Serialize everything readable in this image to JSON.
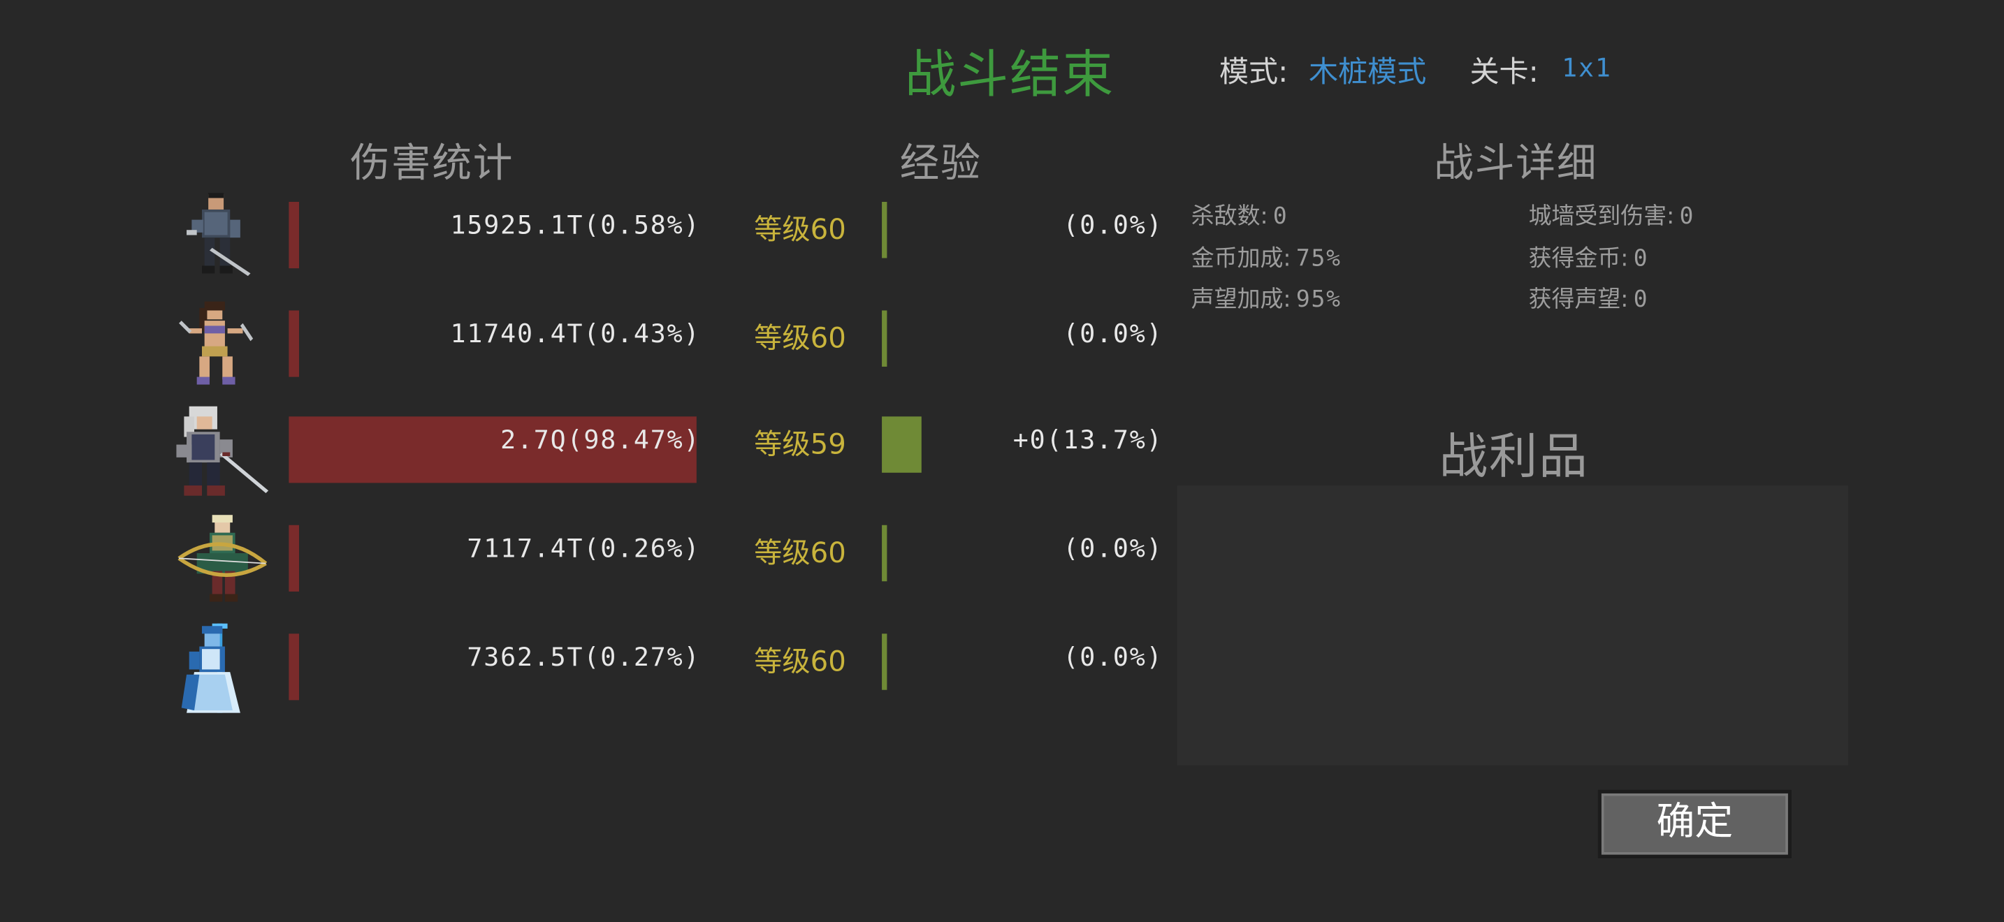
{
  "title": "战斗结束",
  "mode": {
    "label": "模式:",
    "value": "木桩模式"
  },
  "stage": {
    "label": "关卡:",
    "value": "1x1"
  },
  "sections": {
    "damage": "伤害统计",
    "experience": "经验",
    "details": "战斗详细",
    "loot": "战利品"
  },
  "heroes": [
    {
      "damage_text": "15925.1T(0.58%)",
      "damage_share": 0.0058,
      "level_text": "等级60",
      "exp_text": "(0.0%)",
      "exp_progress": 0.0
    },
    {
      "damage_text": "11740.4T(0.43%)",
      "damage_share": 0.0043,
      "level_text": "等级60",
      "exp_text": "(0.0%)",
      "exp_progress": 0.0
    },
    {
      "damage_text": "2.7Q(98.47%)",
      "damage_share": 0.9847,
      "level_text": "等级59",
      "exp_text": "+0(13.7%)",
      "exp_progress": 0.137
    },
    {
      "damage_text": "7117.4T(0.26%)",
      "damage_share": 0.0026,
      "level_text": "等级60",
      "exp_text": "(0.0%)",
      "exp_progress": 0.0
    },
    {
      "damage_text": "7362.5T(0.27%)",
      "damage_share": 0.0027,
      "level_text": "等级60",
      "exp_text": "(0.0%)",
      "exp_progress": 0.0
    }
  ],
  "details": {
    "kills": {
      "label": "杀敌数:",
      "value": "0"
    },
    "wall_damage": {
      "label": "城墙受到伤害:",
      "value": "0"
    },
    "gold_bonus": {
      "label": "金币加成:",
      "value": "75%"
    },
    "gold_earned": {
      "label": "获得金币:",
      "value": "0"
    },
    "fame_bonus": {
      "label": "声望加成:",
      "value": "95%"
    },
    "fame_earned": {
      "label": "获得声望:",
      "value": "0"
    }
  },
  "confirm_label": "确定",
  "colors": {
    "background": "#282828",
    "title_green": "#3e9a3e",
    "damage_bar": "#7a2b2b",
    "exp_bar": "#6f8a36",
    "level_gold": "#c9b43c",
    "link_blue": "#3f8fd0"
  },
  "portrait_icons": [
    "swordsman-hero-icon",
    "dancer-hero-icon",
    "silver-haired-swordsman-hero-icon",
    "elf-archer-hero-icon",
    "ice-mage-hero-icon"
  ]
}
